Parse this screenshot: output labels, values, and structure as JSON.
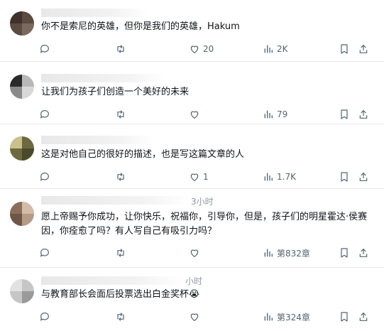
{
  "replies": [
    {
      "handle_extra": "",
      "text": "你不是索尼的英雄，但你是我们的英雄，Hakum",
      "stats": {
        "comments": "",
        "retweets": "",
        "likes": "20",
        "views": "2K"
      }
    },
    {
      "handle_extra": "",
      "text": "让我们为孩子们创造一个美好的未来",
      "stats": {
        "comments": "",
        "retweets": "",
        "likes": "",
        "views": "79"
      }
    },
    {
      "handle_extra": "",
      "text": "这是对他自己的很好的描述，也是写这篇文章的人",
      "stats": {
        "comments": "",
        "retweets": "",
        "likes": "1",
        "views": "1.7K"
      }
    },
    {
      "handle_extra": "3小时",
      "text": "愿上帝赐予你成功，让你快乐，祝福你，引导你，但是，孩子们的明星霍达·侯赛因，你痊愈了吗？有人写自己有吸引力吗？",
      "stats": {
        "comments": "",
        "retweets": "",
        "likes": "",
        "views": "第832章"
      }
    },
    {
      "handle_extra": "小时",
      "text": "与教育部长会面后投票选出白金奖杯😭",
      "stats": {
        "comments": "",
        "retweets": "",
        "likes": "",
        "views": "第324章"
      }
    }
  ]
}
